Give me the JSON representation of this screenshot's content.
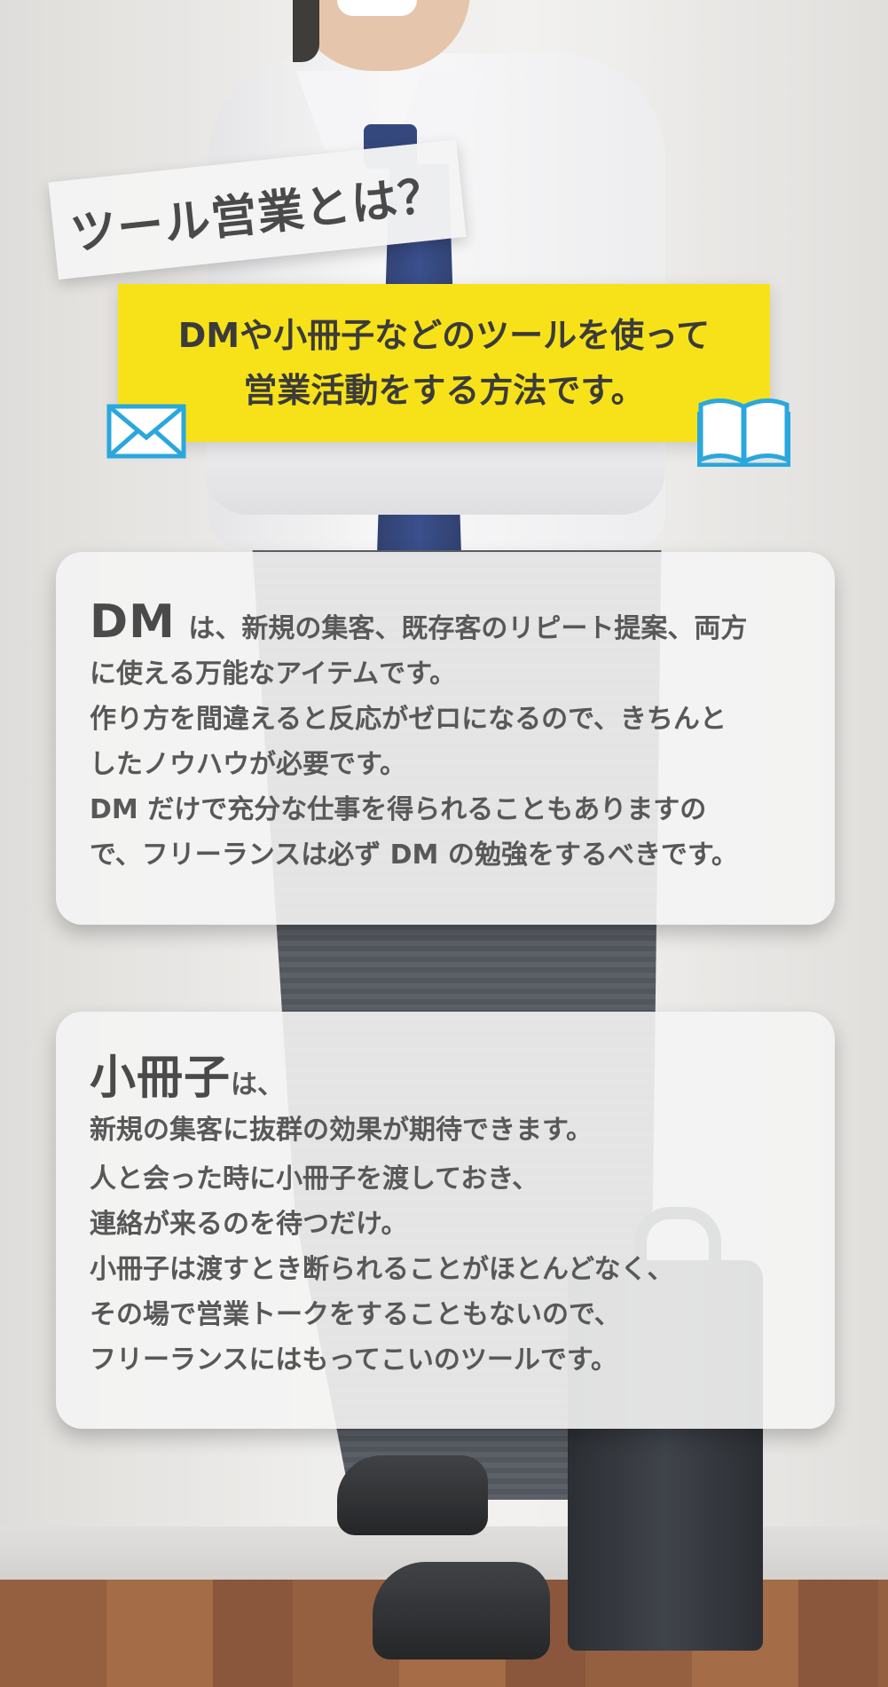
{
  "headline": {
    "title": "ツール営業とは？",
    "tagline_line1": "DMや小冊子などのツールを使って",
    "tagline_line2": "営業活動をする方法です。"
  },
  "icons": {
    "left": "envelope-icon",
    "right": "open-book-icon",
    "accent_color": "#2aa7dd"
  },
  "dm_card": {
    "lead": "DM",
    "line1": "は、新規の集客、既存客のリピート提案、両方",
    "line2": "に使える万能なアイテムです。",
    "line3": "作り方を間違えると反応がゼロになるので、きちんと",
    "line4": "したノウハウが必要です。",
    "line5": "DM だけで充分な仕事を得られることもありますの",
    "line6": "で、フリーランスは必ず DM の勉強をするべきです。"
  },
  "booklet_card": {
    "lead": "小冊子",
    "lead_suffix": "は、",
    "line1": "新規の集客に抜群の効果が期待できます。",
    "line2": "人と会った時に小冊子を渡しておき、",
    "line3": "連絡が来るのを待つだけ。",
    "line4": "小冊子は渡すとき断られることがほとんどなく、",
    "line5": "その場で営業トークをすることもないので、",
    "line6": "フリーランスにはもってこいのツールです。"
  },
  "colors": {
    "highlight_yellow": "#f7e21a",
    "text_gray": "#555555",
    "tie_navy": "#1f3470"
  }
}
